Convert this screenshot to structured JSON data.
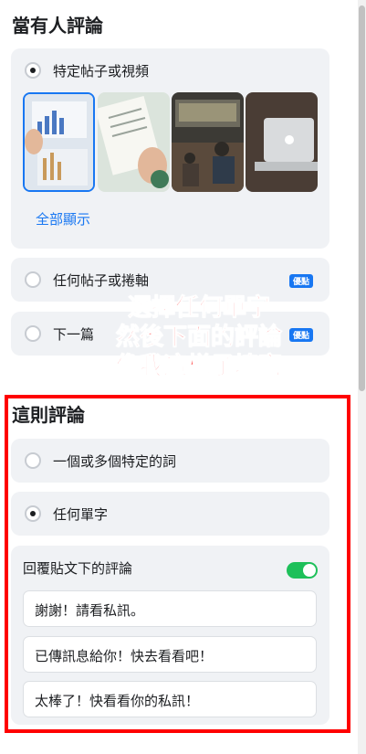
{
  "section_when": {
    "title": "當有人評論"
  },
  "option_specific_post": {
    "label": "特定帖子或視頻"
  },
  "show_all": {
    "label": "全部顯示"
  },
  "option_any_post": {
    "label": "任何帖子或捲軸",
    "badge": "優點"
  },
  "option_next": {
    "label": "下一篇",
    "badge": "優點"
  },
  "annotation": {
    "line1": "選擇任何單字",
    "line2": "然後下面的評論",
    "line3": "像我這樣子填寫"
  },
  "section_this_comment": {
    "title": "這則評論"
  },
  "option_specific_words": {
    "label": "一個或多個特定的詞"
  },
  "option_any_word": {
    "label": "任何單字"
  },
  "reply_toggle": {
    "label": "回覆貼文下的評論",
    "state": "on"
  },
  "replies": [
    "謝謝！請看私訊。",
    "已傳訊息給你！快去看看吧！",
    "太棒了！快看看你的私訊！"
  ],
  "colors": {
    "accent": "#1877f2",
    "toggle_on": "#1ec05a",
    "highlight": "#ff0000"
  }
}
